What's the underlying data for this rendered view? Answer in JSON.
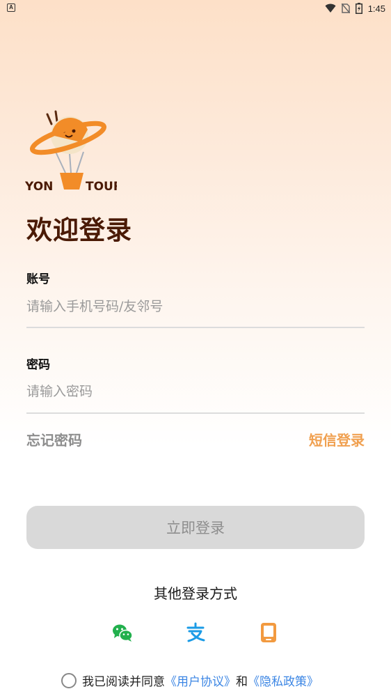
{
  "status_bar": {
    "left_icon": "A",
    "time": "1:45"
  },
  "logo": {
    "text_left": "YON",
    "text_right": "TOUR"
  },
  "title": "欢迎登录",
  "account": {
    "label": "账号",
    "placeholder": "请输入手机号码/友邻号",
    "value": ""
  },
  "password": {
    "label": "密码",
    "placeholder": "请输入密码",
    "value": ""
  },
  "forgot_password": "忘记密码",
  "sms_login": "短信登录",
  "login_button": "立即登录",
  "other_login": {
    "title": "其他登录方式",
    "methods": [
      {
        "icon": "wechat-icon",
        "color": "#22b04d"
      },
      {
        "icon": "alipay-icon",
        "color": "#1a9be6"
      },
      {
        "icon": "phone-icon",
        "color": "#f29a40"
      }
    ]
  },
  "agreement": {
    "prefix": "我已阅读并同意",
    "user_agreement": "《用户协议》",
    "and": "和",
    "privacy_policy": "《隐私政策》"
  },
  "colors": {
    "title": "#4a1a05",
    "accent": "#f0a050",
    "link": "#3c86e4",
    "button_bg": "#d9d9d9"
  }
}
